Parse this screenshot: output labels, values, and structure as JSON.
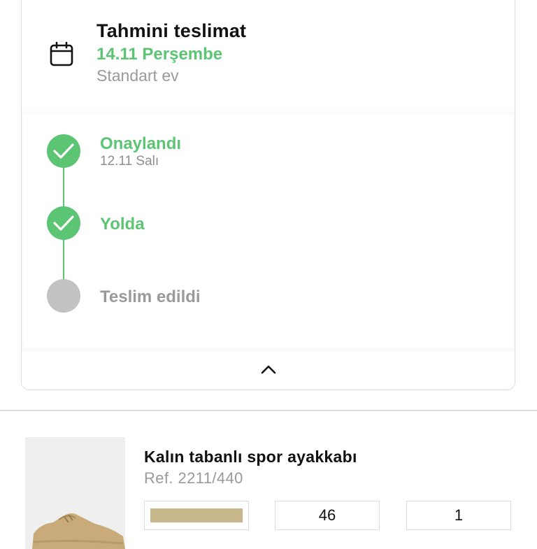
{
  "delivery": {
    "title": "Tahmini teslimat",
    "date": "14.11 Perşembe",
    "method": "Standart ev",
    "icon": "calendar-icon"
  },
  "tracking": {
    "steps": [
      {
        "label": "Onaylandı",
        "date": "12.11 Salı",
        "status": "done"
      },
      {
        "label": "Yolda",
        "date": "",
        "status": "done"
      },
      {
        "label": "Teslim edildi",
        "date": "",
        "status": "pending"
      }
    ],
    "collapse_icon": "chevron-up-icon"
  },
  "product": {
    "name": "Kalın tabanlı spor ayakkabı",
    "ref": "Ref.  2211/440",
    "color_swatch": "#c8b78c",
    "size": "46",
    "quantity": "1"
  },
  "colors": {
    "accent_green": "#5cc573",
    "pending_gray": "#c2c2c2",
    "muted_text": "#9a9a9a"
  }
}
